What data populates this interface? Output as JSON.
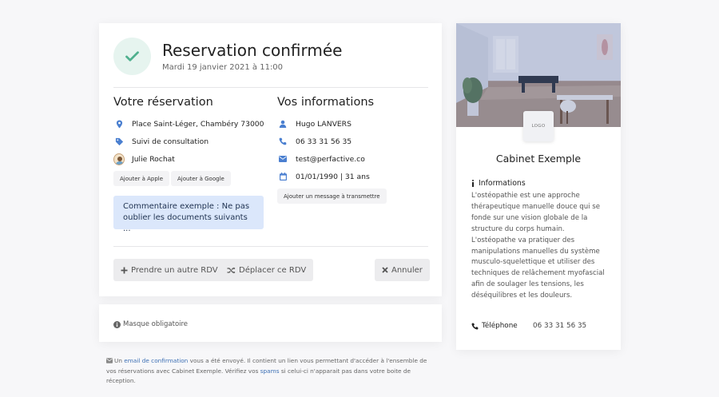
{
  "header": {
    "title": "Reservation confirmée",
    "date": "Mardi 19 janvier 2021 à 11:00"
  },
  "reservation": {
    "title": "Votre réservation",
    "address": "Place Saint-Léger, Chambéry 73000",
    "type": "Suivi de consultation",
    "practitioner": "Julie Rochat",
    "add_apple": "Ajouter à Apple",
    "add_google": "Ajouter à Google",
    "comment": "Commentaire exemple : Ne pas oublier les documents suivants ..."
  },
  "user_info": {
    "title": "Vos informations",
    "name": "Hugo LANVERS",
    "phone": "06 33 31 56 35",
    "email": "test@perfactive.co",
    "birth": "01/01/1990 | 31 ans",
    "message_button": "Ajouter un message à transmettre"
  },
  "actions": {
    "new_appointment": "Prendre un autre RDV",
    "move": "Déplacer ce RDV",
    "cancel": "Annuler"
  },
  "mask": {
    "text": "Masque obligatoire"
  },
  "footer": {
    "part1": "Un ",
    "link1": "email de confirmation",
    "part2": " vous a été envoyé. Il contient un lien vous permettant d'accéder à l'ensemble de vos réservations avec Cabinet Exemple. Vérifiez vos ",
    "link2": "spams",
    "part3": " si celui-ci n'apparait pas dans votre boite de réception."
  },
  "cabinet": {
    "logo": "LOGO",
    "name": "Cabinet Exemple",
    "info_title": "Informations",
    "info_text": "L'ostéopathie est une approche thérapeutique manuelle douce qui se fonde sur une vision globale de la structure du corps humain. L'ostéopathe va pratiquer des manipulations manuelles du système musculo-squelettique et utiliser des techniques de relâchement myofascial afin de soulager les tensions, les déséquilibres et les douleurs.",
    "phone_label": "Téléphone",
    "phone": "06 33 31 56 35"
  },
  "colors": {
    "accent_blue": "#4a7fd0",
    "success_green": "#4fb08e",
    "comment_bg": "#dbe7fb"
  },
  "icons": {
    "check": "check-icon",
    "address": "map-marker-icon",
    "type": "tag-icon",
    "user": "user-icon",
    "phone": "phone-icon",
    "email": "envelope-icon",
    "birth": "calendar-icon",
    "plus": "plus-icon",
    "move": "shuffle-icon",
    "cancel": "times-icon",
    "info": "info-circle-icon"
  }
}
